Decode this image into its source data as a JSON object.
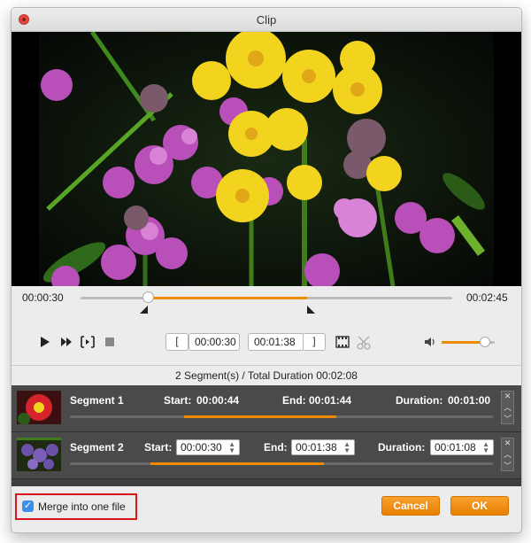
{
  "window": {
    "title": "Clip"
  },
  "timeline": {
    "start_time": "00:00:30",
    "end_time": "00:02:45",
    "selection_start_fraction": 0.18,
    "selection_end_fraction": 0.61
  },
  "controls": {
    "clip_start": "00:00:30",
    "clip_end": "00:01:38",
    "volume_fraction": 0.82
  },
  "summary": "2 Segment(s) / Total Duration 00:02:08",
  "segments": [
    {
      "name": "Segment 1",
      "start_label": "Start:",
      "start": "00:00:44",
      "end_label": "End:",
      "end": "00:01:44",
      "duration_label": "Duration:",
      "duration": "00:01:00",
      "range_start_fraction": 0.27,
      "range_end_fraction": 0.63
    },
    {
      "name": "Segment 2",
      "start_label": "Start:",
      "start": "00:00:30",
      "end_label": "End:",
      "end": "00:01:38",
      "duration_label": "Duration:",
      "duration": "00:01:08",
      "range_start_fraction": 0.19,
      "range_end_fraction": 0.6
    }
  ],
  "footer": {
    "merge_label": "Merge into one file",
    "merge_checked": true,
    "cancel_label": "Cancel",
    "ok_label": "OK"
  },
  "colors": {
    "accent": "#f08a00",
    "highlight_border": "#d9141b",
    "checkbox": "#3b8fe6"
  },
  "icons": {
    "play": "play-icon",
    "forward": "fast-forward-icon",
    "step": "frame-step-icon",
    "stop": "stop-icon",
    "new_clip": "film-clip-icon",
    "delete_clip": "scissors-icon",
    "volume": "speaker-icon"
  }
}
